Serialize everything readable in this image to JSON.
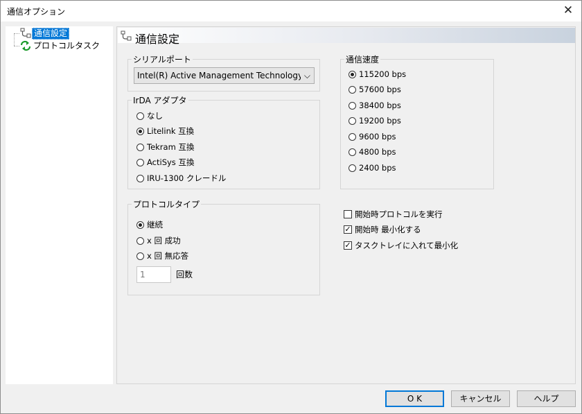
{
  "window": {
    "title": "通信オプション",
    "close_glyph": "✕"
  },
  "tree": {
    "items": [
      {
        "label": "通信設定",
        "icon": "connection-settings-icon",
        "selected": true
      },
      {
        "label": "プロトコルタスク",
        "icon": "protocol-task-icon",
        "selected": false
      }
    ]
  },
  "panel": {
    "title": "通信設定"
  },
  "serial_port": {
    "legend": "シリアルポート",
    "selected": "Intel(R) Active Management Technology - SO"
  },
  "irda": {
    "legend": "IrDA アダプタ",
    "options": [
      "なし",
      "Litelink 互換",
      "Tekram 互換",
      "ActiSys 互換",
      "IRU-1300 クレードル"
    ],
    "selected_index": 1
  },
  "protocol_type": {
    "legend": "プロトコルタイプ",
    "options": [
      "継続",
      "x 回 成功",
      "x 回 無応答"
    ],
    "selected_index": 0,
    "count_value": "1",
    "count_label": "回数"
  },
  "baud_rate": {
    "legend": "通信速度",
    "options": [
      "115200 bps",
      "57600 bps",
      "38400 bps",
      "19200 bps",
      "9600 bps",
      "4800 bps",
      "2400 bps"
    ],
    "selected_index": 0
  },
  "checkboxes": [
    {
      "label": "開始時プロトコルを実行",
      "checked": false
    },
    {
      "label": "開始時 最小化する",
      "checked": true
    },
    {
      "label": "タスクトレイに入れて最小化",
      "checked": true
    }
  ],
  "buttons": {
    "ok": "O K",
    "cancel": "キャンセル",
    "help": "ヘルプ"
  },
  "colors": {
    "selection": "#0078d7",
    "default_button_border": "#0078d7"
  }
}
